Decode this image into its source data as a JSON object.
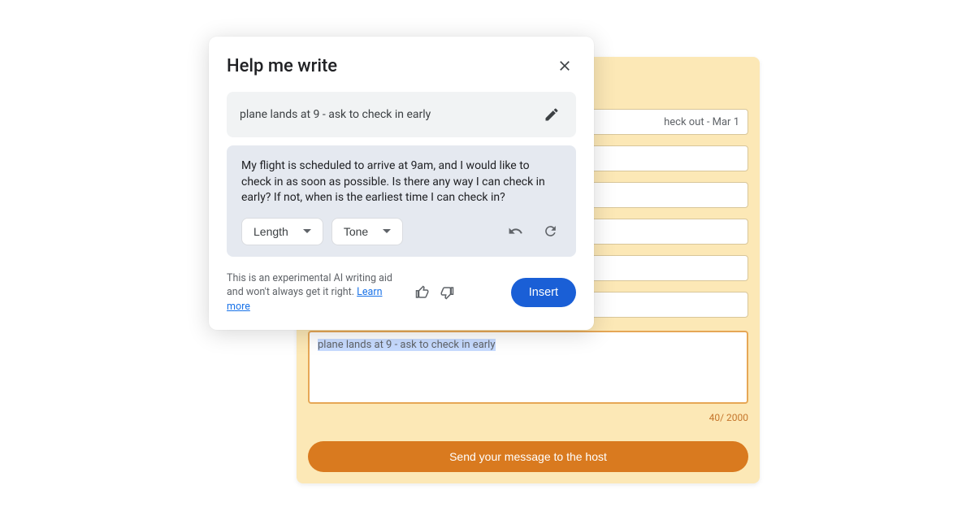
{
  "dialog": {
    "title": "Help me write",
    "prompt": "plane lands at 9 - ask to check in early",
    "result": "My flight is scheduled to arrive at 9am, and I would like to check in as soon as possible. Is there any way I can check in early? If not, when is the earliest time I can check in?",
    "length_label": "Length",
    "tone_label": "Tone",
    "disclaimer": "This is an experimental AI writing aid and won't always get it right.",
    "learn_more": "Learn more",
    "insert_label": "Insert"
  },
  "form": {
    "field1": "heck out - Mar 1",
    "message": "plane lands at 9 - ask to check in early",
    "counter": "40/ 2000",
    "send_label": "Send your message to the host"
  }
}
